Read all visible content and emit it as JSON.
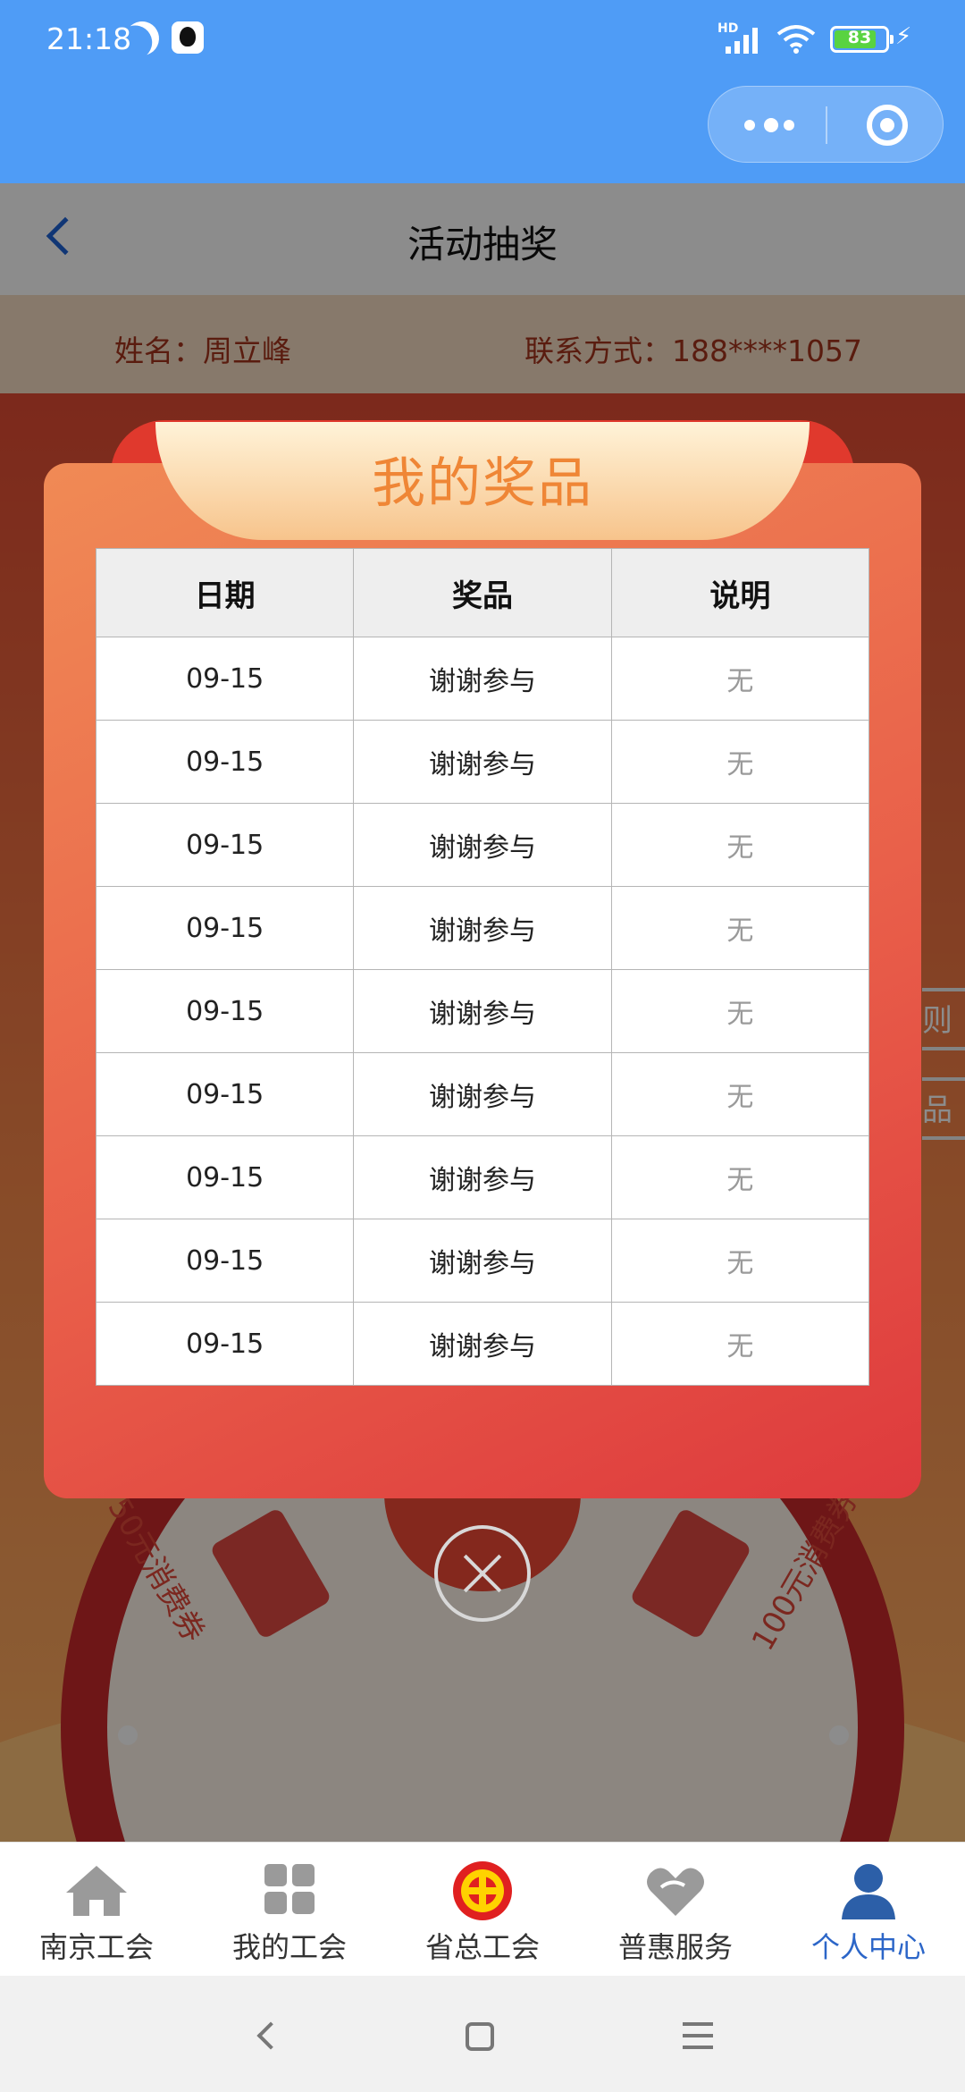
{
  "status_bar": {
    "time": "21:18",
    "network": "HD",
    "battery": "83",
    "battery_level": 0.83,
    "icons": [
      "moon-icon",
      "qq-icon",
      "signal-icon",
      "wifi-icon",
      "battery-icon",
      "charging-icon"
    ]
  },
  "capsule": {
    "more_icon": "more-dots-icon",
    "close_icon": "target-icon"
  },
  "navbar": {
    "title": "活动抽奖",
    "back_icon": "chevron-left-icon"
  },
  "user_info": {
    "name": "姓名：周立峰",
    "contact": "联系方式：188****1057"
  },
  "background": {
    "wheel_left": "50元消费券",
    "wheel_right": "100元消费券",
    "side_tag_1": "则",
    "side_tag_2": "品"
  },
  "modal": {
    "title": "我的奖品",
    "columns": [
      "日期",
      "奖品",
      "说明"
    ],
    "rows": [
      [
        "09-15",
        "谢谢参与",
        "无"
      ],
      [
        "09-15",
        "谢谢参与",
        "无"
      ],
      [
        "09-15",
        "谢谢参与",
        "无"
      ],
      [
        "09-15",
        "谢谢参与",
        "无"
      ],
      [
        "09-15",
        "谢谢参与",
        "无"
      ],
      [
        "09-15",
        "谢谢参与",
        "无"
      ],
      [
        "09-15",
        "谢谢参与",
        "无"
      ],
      [
        "09-15",
        "谢谢参与",
        "无"
      ],
      [
        "09-15",
        "谢谢参与",
        "无"
      ]
    ],
    "close_icon": "close-circle-icon"
  },
  "tabbar": {
    "items": [
      {
        "label": "南京工会",
        "icon": "home-icon",
        "active": false
      },
      {
        "label": "我的工会",
        "icon": "grid-icon",
        "active": false
      },
      {
        "label": "省总工会",
        "icon": "union-emblem-icon",
        "active": false
      },
      {
        "label": "普惠服务",
        "icon": "heart-icon",
        "active": false
      },
      {
        "label": "个人中心",
        "icon": "person-icon",
        "active": true
      }
    ]
  },
  "colors": {
    "header_blue": "#4f9cf6",
    "modal_start": "#f08a55",
    "modal_end": "#de3a3d",
    "title_orange": "#ef8636",
    "active_tab": "#2c66c8"
  }
}
